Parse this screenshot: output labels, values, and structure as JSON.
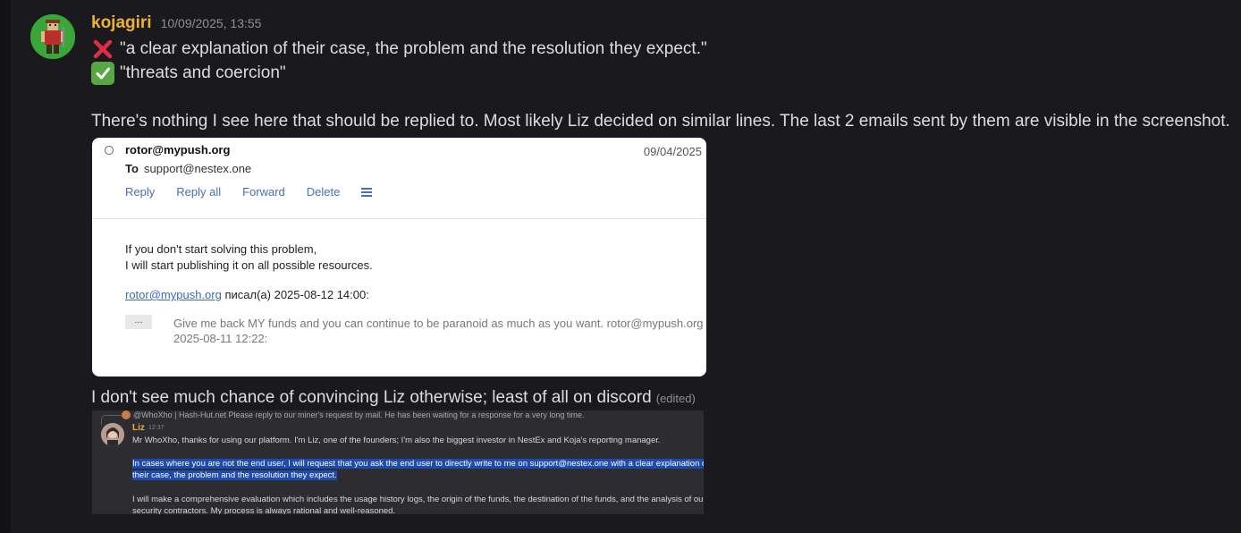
{
  "message": {
    "author": "kojagiri",
    "timestamp": "10/09/2025, 13:55",
    "lines": [
      "\"a clear explanation of their case, the problem and the resolution they expect.\"",
      "\"threats and coercion\"",
      "There's nothing I see here that should be replied to. Most likely Liz decided on similar lines. The last 2 emails sent by them are visible in the screenshot.",
      "I don't see much chance of convincing Liz otherwise; least of all on discord"
    ],
    "edited_label": "(edited)",
    "emojis": [
      "cross-mark-icon",
      "check-mark-icon"
    ]
  },
  "email": {
    "from": "rotor@mypush.org",
    "date": "09/04/2025",
    "to_label": "To",
    "to": "support@nestex.one",
    "actions": [
      "Reply",
      "Reply all",
      "Forward",
      "Delete"
    ],
    "body_line1": "If you don't start solving this problem,",
    "body_line2": "I will start publishing it on all possible resources.",
    "quote_link": "rotor@mypush.org",
    "quote_header_rest": " писал(а) 2025-08-12 14:00:",
    "ellipsis": "...",
    "quoted_line1": "Give me back MY funds and you can continue to be paranoid as much as you want. rotor@mypush.org писа",
    "quoted_line2": "2025-08-11 12:22:"
  },
  "discord_shot": {
    "reply_text": "@WhoXho | Hash-Hut.net Please reply to our miner's request by mail. He has been waiting for a response for a very long time.",
    "author": "Liz",
    "time": "12:37",
    "line1": "Mr WhoXho, thanks for using our platform. I'm Liz, one of the founders; I'm also the biggest investor in NestEx and Koja's reporting manager.",
    "highlight1": "In cases where you are not the end user, I will request that you ask the end user to directly write to me on support@nestex.one with a clear explanation of",
    "highlight2": "their case, the problem and the resolution they expect.",
    "line3": "I will make a comprehensive evaluation which includes the usage history logs, the origin of the funds, the destination of the funds, and the analysis of our",
    "line4": "security contractors. My process is always rational and well-reasoned."
  },
  "colors": {
    "background": "#1a1a1e",
    "username": "#f0b232",
    "text": "#dbdee1",
    "muted": "#8e9096",
    "link": "#3b6bb5",
    "highlight": "#1d4bb0"
  }
}
